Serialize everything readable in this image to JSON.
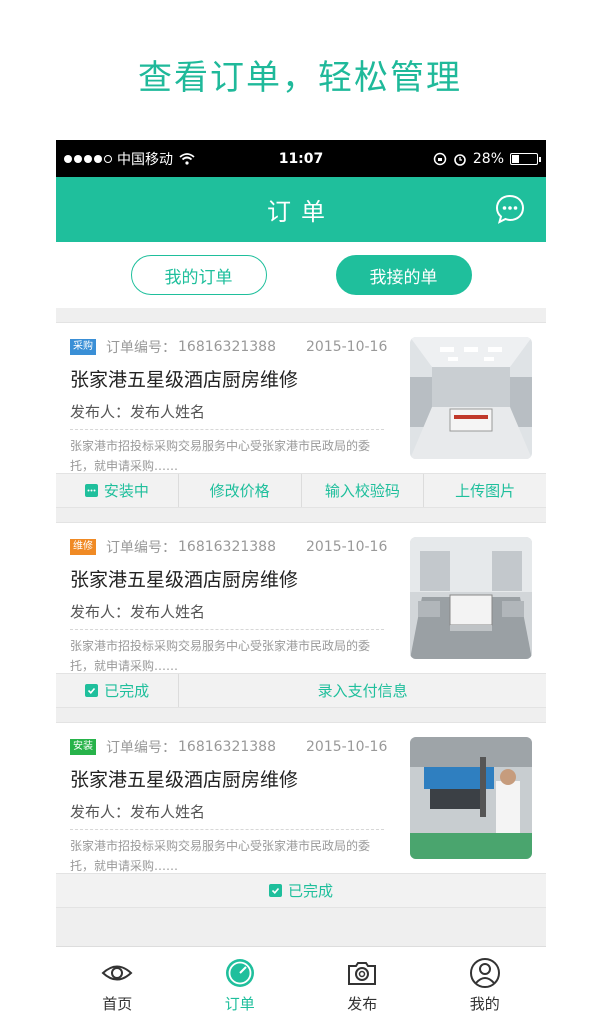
{
  "headline": "查看订单，轻松管理",
  "status_bar": {
    "carrier": "中国移动",
    "time": "11:07",
    "battery": "28%",
    "battery_level": 0.28
  },
  "nav": {
    "title": "订单",
    "icon": "chat-bubble-icon"
  },
  "segments": [
    {
      "label": "我的订单",
      "active": false
    },
    {
      "label": "我接的单",
      "active": true
    }
  ],
  "order_no_label": "订单编号：",
  "publisher_label": "发布人：",
  "orders": [
    {
      "tag": "采购",
      "tag_color": "#3a8fd6",
      "order_no": "16816321388",
      "date": "2015-10-16",
      "title": "张家港五星级酒店厨房维修",
      "publisher": "发布人姓名",
      "desc": "张家港市招投标采购交易服务中心受张家港市民政局的委托，就申请采购……",
      "status": "安装中",
      "actions": [
        "修改价格",
        "输入校验码",
        "上传图片"
      ]
    },
    {
      "tag": "维修",
      "tag_color": "#f08a24",
      "order_no": "16816321388",
      "date": "2015-10-16",
      "title": "张家港五星级酒店厨房维修",
      "publisher": "发布人姓名",
      "desc": "张家港市招投标采购交易服务中心受张家港市民政局的委托，就申请采购……",
      "status": "已完成",
      "actions": [
        "录入支付信息"
      ]
    },
    {
      "tag": "安装",
      "tag_color": "#27b34a",
      "order_no": "16816321388",
      "date": "2015-10-16",
      "title": "张家港五星级酒店厨房维修",
      "publisher": "发布人姓名",
      "desc": "张家港市招投标采购交易服务中心受张家港市民政局的委托，就申请采购……",
      "status": "已完成",
      "actions": []
    }
  ],
  "tabs": [
    {
      "label": "首页",
      "icon": "eye-icon",
      "active": false
    },
    {
      "label": "订单",
      "icon": "clock-icon",
      "active": true
    },
    {
      "label": "发布",
      "icon": "camera-icon",
      "active": false
    },
    {
      "label": "我的",
      "icon": "user-icon",
      "active": false
    }
  ],
  "colors": {
    "primary": "#1fbf9c",
    "headline": "#1fb99a"
  }
}
